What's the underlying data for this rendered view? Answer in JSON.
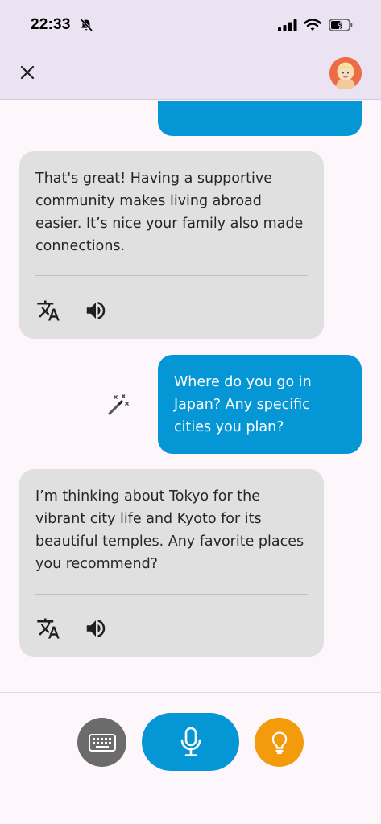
{
  "status_bar": {
    "time": "22:33",
    "icons": [
      "bell-off-icon",
      "cellular-signal-icon",
      "wifi-icon",
      "battery-charging-icon"
    ]
  },
  "app_bar": {
    "close_icon": "close-icon",
    "avatar": "avatar-icon"
  },
  "messages": [
    {
      "role": "bot",
      "text": "That's great! Having a supportive community makes living abroad easier. It’s nice your family also made connections.",
      "actions": [
        "translate-icon",
        "speaker-icon"
      ]
    },
    {
      "role": "user",
      "text": "Where do you go in Japan? Any specific cities you plan?",
      "side_icon": "magic-wand-icon"
    },
    {
      "role": "bot",
      "text": "I’m thinking about Tokyo for the vibrant city life and Kyoto for its beautiful temples. Any favorite places you recommend?",
      "actions": [
        "translate-icon",
        "speaker-icon"
      ]
    }
  ],
  "bottom_bar": {
    "buttons": [
      "keyboard-icon",
      "microphone-icon",
      "lightbulb-icon"
    ]
  },
  "colors": {
    "user_bubble": "#0596d6",
    "bot_bubble": "#e0e0e0",
    "header": "#ebe3f1",
    "hint_button": "#f49b0b",
    "keyboard_button": "#6b6b6b"
  }
}
